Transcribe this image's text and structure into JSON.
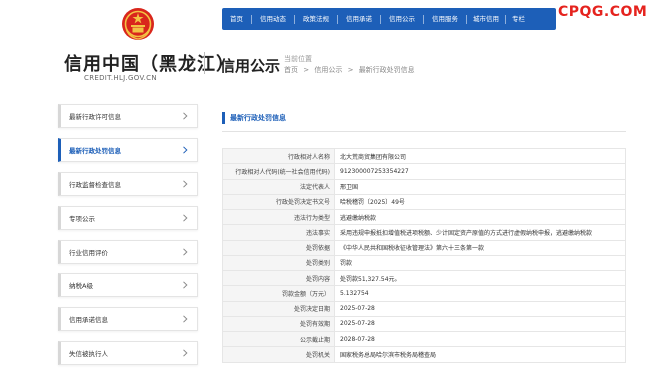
{
  "header": {
    "site_title": "信用中国（黑龙江）",
    "site_domain": "CREDIT.HLJ.GOV.CN",
    "section_name": "信用公示",
    "crumb_label": "当前位置",
    "breadcrumb": [
      "首页",
      ">",
      "信用公示",
      ">",
      "最新行政处罚信息"
    ],
    "watermark": "CPQG.COM",
    "emblem_icon": "national-emblem-icon"
  },
  "topnav": {
    "items": [
      "首页",
      "信用动态",
      "政策法规",
      "信用承诺",
      "信用公示",
      "信用服务",
      "城市信用",
      "专栏"
    ]
  },
  "sidebar": {
    "items": [
      {
        "label": "最新行政许可信息",
        "active": false
      },
      {
        "label": "最新行政处罚信息",
        "active": true
      },
      {
        "label": "行政监督检查信息",
        "active": false
      },
      {
        "label": "专项公示",
        "active": false
      },
      {
        "label": "行业信用评价",
        "active": false
      },
      {
        "label": "纳税A级",
        "active": false
      },
      {
        "label": "信用承诺信息",
        "active": false
      },
      {
        "label": "失信被执行人",
        "active": false
      }
    ]
  },
  "main": {
    "panel_title": "最新行政处罚信息",
    "rows": [
      {
        "k": "行政相对人名称",
        "v": "北大荒商贸集团有限公司"
      },
      {
        "k": "行政相对人代码(统一社会信用代码)",
        "v": "91230000725335422​7"
      },
      {
        "k": "法定代表人",
        "v": "邢卫国"
      },
      {
        "k": "行政处罚决定书文号",
        "v": "哈税稽罚〔2025〕49号"
      },
      {
        "k": "违法行为类型",
        "v": "逃避缴纳税款"
      },
      {
        "k": "违法事实",
        "v": "采用违规申报抵扣增值税进项税额、少计固定资产原值的方式进行虚假纳税申报，逃避缴纳税款"
      },
      {
        "k": "处罚依据",
        "v": "《中华人民共和国税收征收管理法》第六十三条第一款"
      },
      {
        "k": "处罚类别",
        "v": "罚款"
      },
      {
        "k": "处罚内容",
        "v": "处罚款51,327.54元。"
      },
      {
        "k": "罚款金额（万元）",
        "v": "5.132754"
      },
      {
        "k": "处罚决定日期",
        "v": "2025-07-28"
      },
      {
        "k": "处罚有效期",
        "v": "2025-07-28"
      },
      {
        "k": "公示截止期",
        "v": "2028-07-28"
      },
      {
        "k": "处罚机关",
        "v": "国家税务总局哈尔滨市税务局稽查局"
      }
    ]
  },
  "colors": {
    "brand_blue": "#1d5fb8",
    "watermark_red": "#e5231e"
  }
}
